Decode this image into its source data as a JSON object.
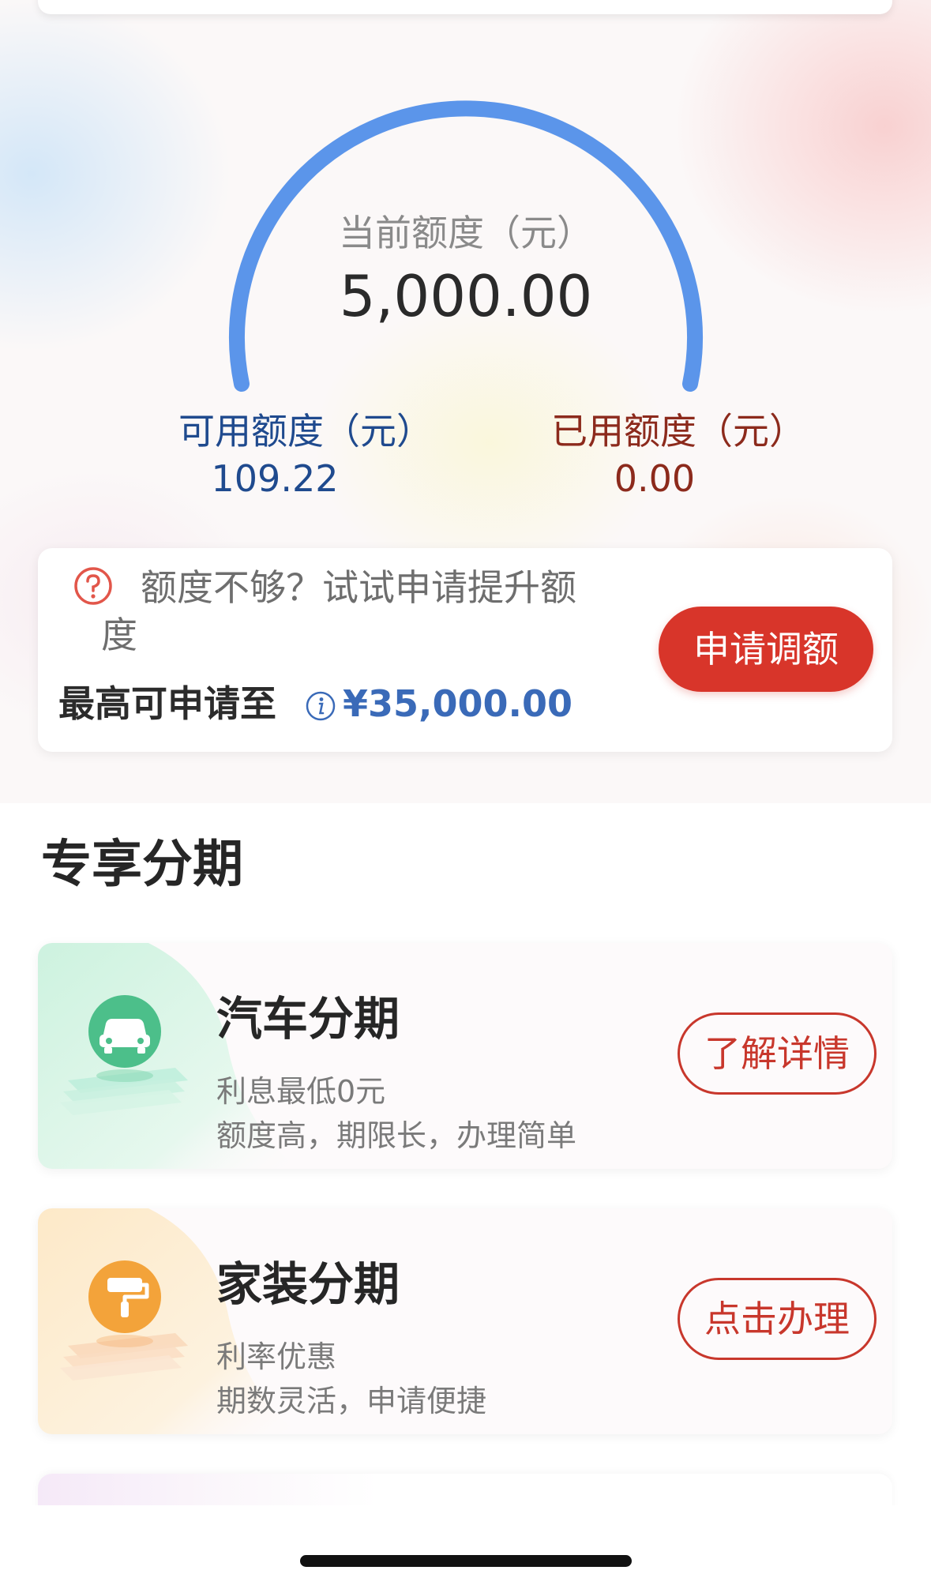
{
  "quota": {
    "current_label": "当前额度（元）",
    "current_value": "5,000.00",
    "available_label": "可用额度（元）",
    "available_value": "109.22",
    "used_label": "已用额度（元）",
    "used_value": "0.00"
  },
  "apply": {
    "tip": "额度不够？试试申请提升额度",
    "max_label": "最高可申请至",
    "max_value": "¥35,000.00",
    "button_label": "申请调额"
  },
  "section": {
    "title": "专享分期"
  },
  "promos": [
    {
      "title": "汽车分期",
      "line1": "利息最低0元",
      "line2": "额度高，期限长，办理简单",
      "button_label": "了解详情",
      "icon": "car-icon"
    },
    {
      "title": "家装分期",
      "line1": "利率优惠",
      "line2": "期数灵活，申请便捷",
      "button_label": "点击办理",
      "icon": "paint-roller-icon"
    }
  ],
  "colors": {
    "gauge_arc": "#5b95ea",
    "primary_red": "#d8352a",
    "available_blue": "#1f4a8e",
    "used_brown": "#8c2a1c",
    "max_value_blue": "#3a6ab8",
    "car_green": "#4cc08a",
    "home_orange": "#f3a33a"
  }
}
